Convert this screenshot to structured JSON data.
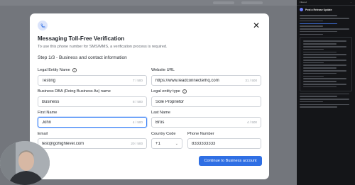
{
  "panel": {
    "top_left": "Filtered",
    "top_right": "...",
    "item_title": "Post a Release Update",
    "accent": "#3d6dd6"
  },
  "modal": {
    "title": "Messaging Toll-Free Verification",
    "subtitle": "To use this phone number for SMS/MMS, a verification process is required.",
    "step": "Step 1/3 - Business and contact information",
    "icons": {
      "phone": "phone-icon",
      "close": "close-icon",
      "info": "info-icon"
    },
    "fields": {
      "legal_entity_name": {
        "label": "Legal Entity Name",
        "value": "Testing",
        "count": "7 / 500"
      },
      "website_url": {
        "label": "Website URL",
        "value": "https://www.leadconnecterhq.com",
        "count": "31 / 500"
      },
      "business_dba": {
        "label": "Business DBA (Doing Business As) name",
        "value": "Business",
        "count": "8 / 500"
      },
      "legal_entity_type": {
        "label": "Legal entity type",
        "value": "Sole Proprietor"
      },
      "first_name": {
        "label": "First Name",
        "value": "John",
        "count": "4 / 500"
      },
      "last_name": {
        "label": "Last Name",
        "value": "Bros",
        "count": "4 / 500"
      },
      "email": {
        "label": "Email",
        "value": "test@gohighlevel.com",
        "count": "20 / 500"
      },
      "country_code": {
        "label": "Country Code",
        "value": "+1"
      },
      "phone_number": {
        "label": "Phone Number",
        "value": "8333333333"
      }
    },
    "continue_label": "Continue to Business account",
    "accent": "#2f6fe4"
  }
}
